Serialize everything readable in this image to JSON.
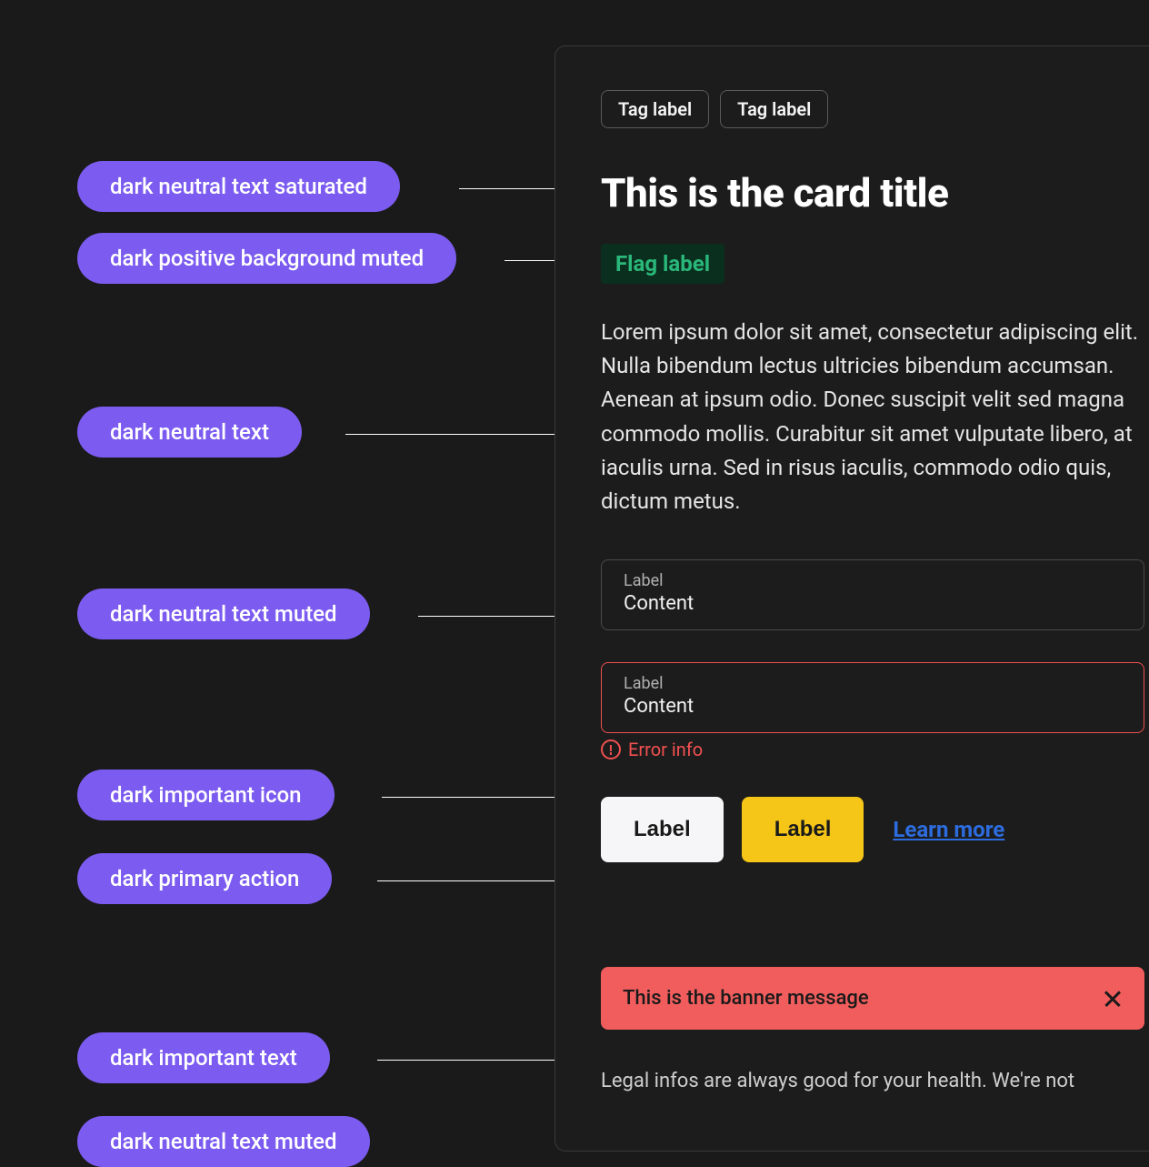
{
  "annotations": {
    "a1": "dark neutral text saturated",
    "a2": "dark positive background muted",
    "a3": "dark neutral text",
    "a4": "dark neutral text muted",
    "a5": "dark important icon",
    "a6": "dark primary action",
    "a7": "dark important text",
    "a8": "dark neutral text muted"
  },
  "card": {
    "tags": {
      "t1": "Tag label",
      "t2": "Tag label"
    },
    "title": "This is the card title",
    "flag": "Flag label",
    "body": "Lorem ipsum dolor sit amet, consectetur adipiscing elit. Nulla bibendum lectus ultricies bibendum accumsan. Aenean at ipsum odio. Donec suscipit velit sed magna commodo mollis. Curabitur sit amet vulputate libero, at iaculis urna. Sed in risus iaculis, commodo odio quis, dictum metus.",
    "field1": {
      "label": "Label",
      "content": "Content"
    },
    "field2": {
      "label": "Label",
      "content": "Content"
    },
    "error": "Error info",
    "buttons": {
      "b1": "Label",
      "b2": "Label"
    },
    "link": "Learn more",
    "banner": "This is the banner message",
    "legal": "Legal infos are always good for your health. We're not"
  },
  "colors": {
    "pill": "#7c5cf0",
    "flag_bg": "#0b2f1e",
    "flag_text": "#2ab77a",
    "error": "#f15050",
    "yellow": "#f5c518",
    "link": "#2d6cdf",
    "banner": "#f15d5d"
  }
}
